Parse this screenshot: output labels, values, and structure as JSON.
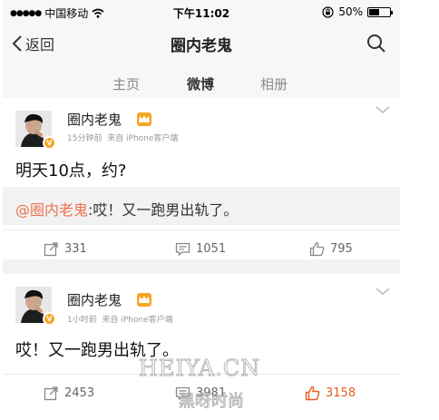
{
  "status_bar": {
    "signal_dots": "●●●●●",
    "carrier": "中国移动",
    "time": "下午11:02",
    "battery": "50%",
    "battery_level": 0.5,
    "icons": [
      "signal-icon",
      "wifi-icon",
      "rotation-lock-icon",
      "battery-icon"
    ]
  },
  "nav": {
    "back_label": "返回",
    "title": "圈内老鬼",
    "icons": [
      "chevron-left-icon",
      "search-icon"
    ]
  },
  "tabs": [
    {
      "label": "主页",
      "active": false
    },
    {
      "label": "微博",
      "active": true
    },
    {
      "label": "相册",
      "active": false
    }
  ],
  "posts": [
    {
      "username": "圈内老鬼",
      "badge": "V",
      "time": "15分钟前",
      "source": "来自 iPhone客户端",
      "text": "明天10点，约?",
      "repost": {
        "user": "@圈内老鬼",
        "text": ":哎！又一跑男出轨了。"
      },
      "reposts": "331",
      "comments": "1051",
      "likes": "795",
      "liked": false
    },
    {
      "username": "圈内老鬼",
      "badge": "V",
      "time": "1小时前",
      "source": "来自 iPhone客户端",
      "text": "哎！又一跑男出轨了。",
      "reposts": "2453",
      "comments": "3981",
      "likes": "3158",
      "liked": true
    }
  ],
  "watermark": {
    "en": "HEIYA.CN",
    "cn": "黑呀时尚"
  },
  "colors": {
    "accent": "#ff8200",
    "link": "#eb7350",
    "like_active": "#e65c1f",
    "badge": "#f5a623"
  }
}
